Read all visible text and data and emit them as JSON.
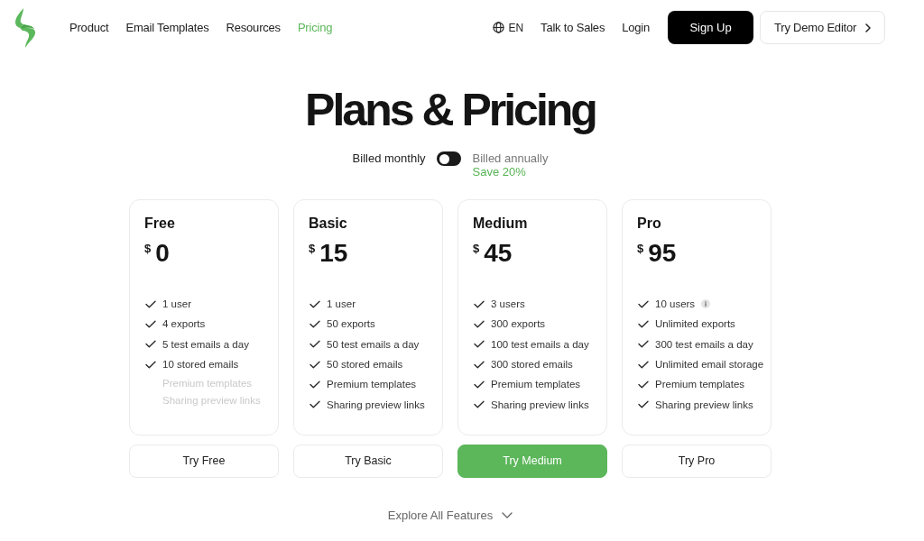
{
  "nav": {
    "items": [
      {
        "label": "Product",
        "selected": false
      },
      {
        "label": "Email Templates",
        "selected": false
      },
      {
        "label": "Resources",
        "selected": false
      },
      {
        "label": "Pricing",
        "selected": true
      }
    ],
    "language": "EN",
    "links": [
      "Talk to Sales",
      "Login"
    ],
    "signup": "Sign Up",
    "demo": "Try Demo Editor"
  },
  "title": "Plans & Pricing",
  "billing": {
    "monthly_label": "Billed monthly",
    "annual": false,
    "annual_label": "Billed annually",
    "savings": "Save 20%"
  },
  "plans": [
    {
      "name": "Free",
      "currency": "$",
      "price": "0",
      "highlighted": false,
      "cta": "Try Free",
      "features": [
        {
          "label": "1 user",
          "included": true,
          "info": false
        },
        {
          "label": "4 exports",
          "included": true,
          "info": false
        },
        {
          "label": "5 test emails a day",
          "included": true,
          "info": false
        },
        {
          "label": "10 stored emails",
          "included": true,
          "info": false
        },
        {
          "label": "Premium templates",
          "included": false,
          "info": false
        },
        {
          "label": "Sharing preview links",
          "included": false,
          "info": false
        }
      ]
    },
    {
      "name": "Basic",
      "currency": "$",
      "price": "15",
      "highlighted": false,
      "cta": "Try Basic",
      "features": [
        {
          "label": "1 user",
          "included": true,
          "info": false
        },
        {
          "label": "50 exports",
          "included": true,
          "info": false
        },
        {
          "label": "50 test emails a day",
          "included": true,
          "info": false
        },
        {
          "label": "50 stored emails",
          "included": true,
          "info": false
        },
        {
          "label": "Premium templates",
          "included": true,
          "info": false
        },
        {
          "label": "Sharing preview links",
          "included": true,
          "info": false
        }
      ]
    },
    {
      "name": "Medium",
      "currency": "$",
      "price": "45",
      "highlighted": true,
      "cta": "Try Medium",
      "features": [
        {
          "label": "3 users",
          "included": true,
          "info": false
        },
        {
          "label": "300 exports",
          "included": true,
          "info": false
        },
        {
          "label": "100 test emails a day",
          "included": true,
          "info": false
        },
        {
          "label": "300 stored emails",
          "included": true,
          "info": false
        },
        {
          "label": "Premium templates",
          "included": true,
          "info": false
        },
        {
          "label": "Sharing preview links",
          "included": true,
          "info": false
        }
      ]
    },
    {
      "name": "Pro",
      "currency": "$",
      "price": "95",
      "highlighted": false,
      "cta": "Try Pro",
      "features": [
        {
          "label": "10 users",
          "included": true,
          "info": true
        },
        {
          "label": "Unlimited exports",
          "included": true,
          "info": false
        },
        {
          "label": "300 test emails a day",
          "included": true,
          "info": false
        },
        {
          "label": "Unlimited email storage",
          "included": true,
          "info": false
        },
        {
          "label": "Premium templates",
          "included": true,
          "info": false
        },
        {
          "label": "Sharing preview links",
          "included": true,
          "info": false
        }
      ]
    }
  ],
  "explore": "Explore All Features"
}
